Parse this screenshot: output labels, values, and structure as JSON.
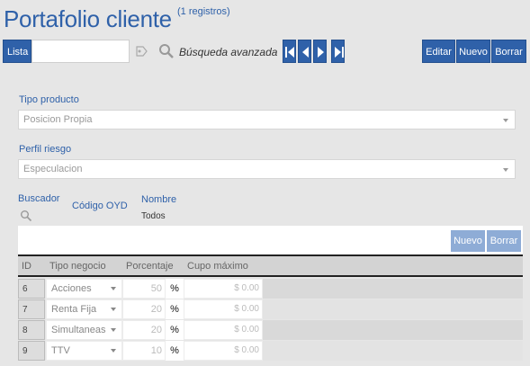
{
  "header": {
    "title": "Portafolio cliente",
    "count": "(1 registros)"
  },
  "toolbar": {
    "lista": "Lista",
    "search_placeholder": "",
    "advanced": "Búsqueda avanzada",
    "editar": "Editar",
    "nuevo": "Nuevo",
    "borrar": "Borrar"
  },
  "form": {
    "tipo_label": "Tipo producto",
    "tipo_value": "Posicion Propia",
    "perfil_label": "Perfil riesgo",
    "perfil_value": "Especulacion"
  },
  "filters": {
    "buscador": "Buscador",
    "codigo": "Código OYD",
    "nombre": "Nombre",
    "todos": "Todos"
  },
  "grid": {
    "nuevo": "Nuevo",
    "borrar": "Borrar",
    "columns": [
      "ID",
      "Tipo negocio",
      "Porcentaje",
      "Cupo máximo"
    ],
    "rows": [
      {
        "id": "6",
        "tipo": "Acciones",
        "pct": "50",
        "sym": "%",
        "cupo": "$ 0.00"
      },
      {
        "id": "7",
        "tipo": "Renta Fija",
        "pct": "20",
        "sym": "%",
        "cupo": "$ 0.00"
      },
      {
        "id": "8",
        "tipo": "Simultaneas",
        "pct": "20",
        "sym": "%",
        "cupo": "$ 0.00"
      },
      {
        "id": "9",
        "tipo": "TTV",
        "pct": "10",
        "sym": "%",
        "cupo": "$ 0.00"
      }
    ]
  },
  "colors": {
    "accent": "#2f61a9",
    "disabled": "#8eacd6",
    "background": "#e6e6e6"
  }
}
